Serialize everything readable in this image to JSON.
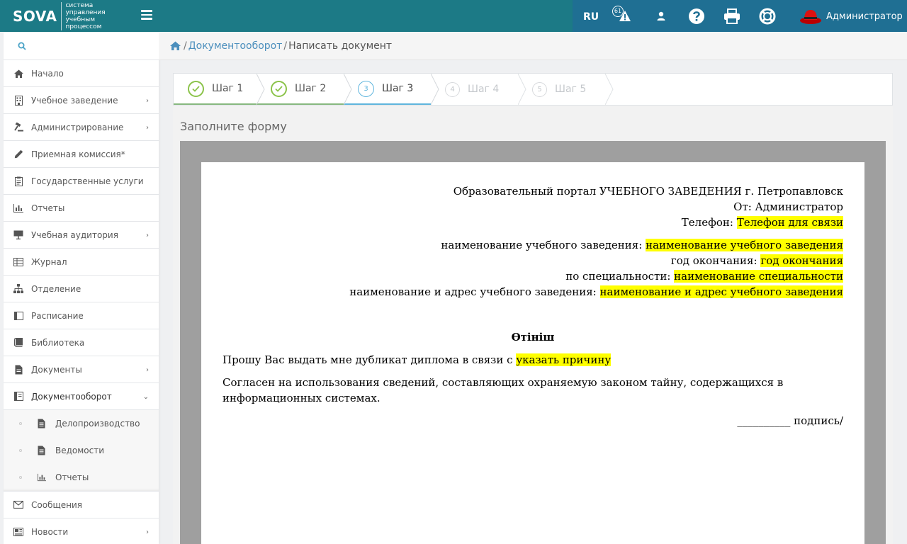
{
  "topbar": {
    "logo_word": "SOVA",
    "logo_sub": "система управления учебным процессом",
    "lang": "RU",
    "notif_count": "61",
    "user": "Администратор"
  },
  "sidebar": {
    "items": [
      {
        "label": "Начало",
        "icon": "home-icon"
      },
      {
        "label": "Учебное заведение",
        "icon": "building-icon",
        "caret": "›"
      },
      {
        "label": "Администрирование",
        "icon": "gavel-icon",
        "caret": "›"
      },
      {
        "label": "Приемная комиссия*",
        "icon": "pencil-icon"
      },
      {
        "label": "Государственные услуги",
        "icon": "clipboard-icon"
      },
      {
        "label": "Отчеты",
        "icon": "bar-chart-icon"
      },
      {
        "label": "Учебная аудитория",
        "icon": "presentation-icon",
        "caret": "›"
      },
      {
        "label": "Журнал",
        "icon": "table-icon"
      },
      {
        "label": "Отделение",
        "icon": "sitemap-icon"
      },
      {
        "label": "Расписание",
        "icon": "calendar-icon"
      },
      {
        "label": "Библиотека",
        "icon": "book-icon"
      },
      {
        "label": "Документы",
        "icon": "file-icon",
        "caret": "›"
      },
      {
        "label": "Документооборот",
        "icon": "book-open-icon",
        "caret": "⌄"
      }
    ],
    "subitems": [
      {
        "label": "Делопроизводство",
        "icon": "file-text-icon"
      },
      {
        "label": "Ведомости",
        "icon": "file-text-icon"
      },
      {
        "label": "Отчеты",
        "icon": "bar-chart-icon"
      }
    ],
    "bottom_items": [
      {
        "label": "Сообщения",
        "icon": "envelope-icon"
      },
      {
        "label": "Новости",
        "icon": "newspaper-icon",
        "caret": "›"
      }
    ]
  },
  "breadcrumb": {
    "link": "Документооборот",
    "current": "Написать документ",
    "sep": "/"
  },
  "wizard": {
    "steps": [
      {
        "label": "Шаг 1",
        "num": "1",
        "state": "done"
      },
      {
        "label": "Шаг 2",
        "num": "2",
        "state": "done"
      },
      {
        "label": "Шаг 3",
        "num": "3",
        "state": "current"
      },
      {
        "label": "Шаг 4",
        "num": "4",
        "state": "future"
      },
      {
        "label": "Шаг 5",
        "num": "5",
        "state": "future"
      }
    ]
  },
  "form": {
    "heading": "Заполните форму"
  },
  "document": {
    "portal": "Образовательный портал УЧЕБНОГО ЗАВЕДЕНИЯ г. Петропавловск",
    "from": "От: Администратор",
    "phone_label": "Телефон: ",
    "phone_value": "Телефон для связи",
    "school_label": "наименование учебного заведения: ",
    "school_value": "наименование учебного заведения",
    "year_label": "год окончания: ",
    "year_value": "год окончания",
    "spec_label": "по специальности: ",
    "spec_value": "наименование специальности",
    "addr_label": "наименование и адрес учебного заведения: ",
    "addr_value": "наименование и адрес учебного заведения",
    "title": "Өтініш",
    "request_text": "Прошу Вас выдать мне дубликат диплома в связи с ",
    "request_value": "указать причину",
    "consent": "Согласен на использования сведений, составляющих охраняемую законом тайну, содержащихся в информационных системах.",
    "sign": "__________ подпись/"
  },
  "colors": {
    "topbar": "#1c7a86",
    "topbar_right": "#1f6f93",
    "highlight": "#ffff00",
    "link": "#4c8fbd",
    "done": "#8bc34a",
    "current": "#5fb5dd"
  }
}
